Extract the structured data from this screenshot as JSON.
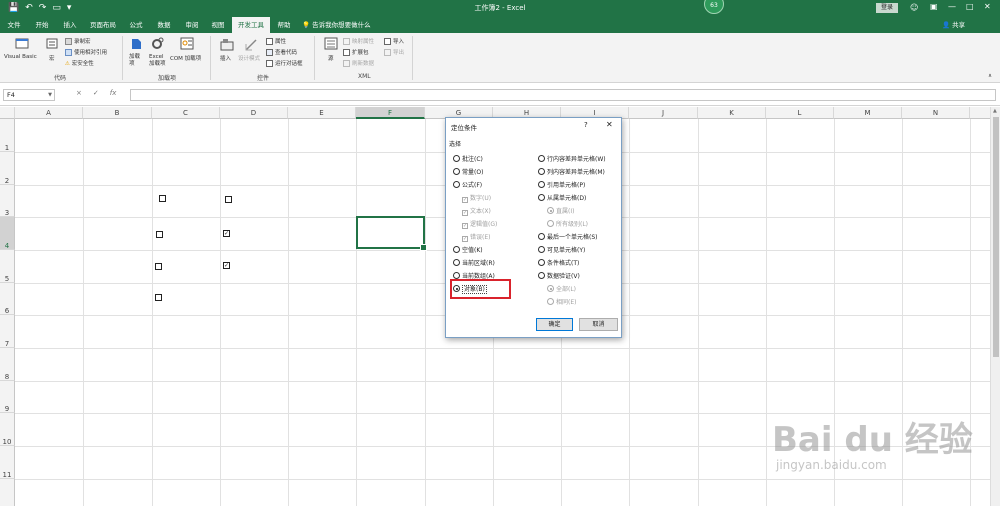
{
  "titlebar": {
    "title": "工作簿2 - Excel",
    "avatar": "63",
    "login": "登录",
    "smile_icon": "smile-icon"
  },
  "tabs": [
    {
      "label": "文件"
    },
    {
      "label": "开始"
    },
    {
      "label": "插入"
    },
    {
      "label": "页面布局"
    },
    {
      "label": "公式"
    },
    {
      "label": "数据"
    },
    {
      "label": "审阅"
    },
    {
      "label": "视图"
    },
    {
      "label": "开发工具",
      "active": true
    },
    {
      "label": "帮助"
    }
  ],
  "tellme": "告诉我你想要做什么",
  "share": "共享",
  "ribbon": {
    "code_group": {
      "visual_basic": "Visual Basic",
      "macros": "宏",
      "record_macro": "录制宏",
      "relative_ref": "使用相对引用",
      "macro_security": "宏安全性",
      "label": "代码"
    },
    "addins_group": {
      "addins": "加载项",
      "excel_addins": "Excel 加载项",
      "com_addins": "COM 加载项",
      "label": "加载项"
    },
    "controls_group": {
      "insert": "插入",
      "design_mode": "设计模式",
      "properties": "属性",
      "view_code": "查看代码",
      "run_dialog": "运行对话框",
      "label": "控件"
    },
    "xml_group": {
      "source": "源",
      "map_props": "映射属性",
      "expansion": "扩展包",
      "refresh": "刷新数据",
      "import": "导入",
      "export": "导出",
      "label": "XML"
    }
  },
  "formula_bar": {
    "name_box": "F4",
    "cancel_icon": "×",
    "enter_icon": "✓",
    "fx": "fx",
    "formula": ""
  },
  "grid": {
    "columns": [
      "A",
      "B",
      "C",
      "D",
      "E",
      "F",
      "G",
      "H",
      "I",
      "J",
      "K",
      "L",
      "M",
      "N"
    ],
    "rows": [
      "1",
      "2",
      "3",
      "4",
      "5",
      "6",
      "7",
      "8",
      "9",
      "10",
      "11"
    ],
    "selected_column": "F",
    "selected_row": "4"
  },
  "dialog": {
    "title": "定位条件",
    "help": "?",
    "close": "✕",
    "section": "选择",
    "left_options": [
      {
        "label": "批注(C)"
      },
      {
        "label": "常量(O)"
      },
      {
        "label": "公式(F)"
      },
      {
        "label": "数字(U)",
        "sub": true
      },
      {
        "label": "文本(X)",
        "sub": true
      },
      {
        "label": "逻辑值(G)",
        "sub": true
      },
      {
        "label": "错误(E)",
        "sub": true
      },
      {
        "label": "空值(K)"
      },
      {
        "label": "当前区域(R)"
      },
      {
        "label": "当前数组(A)"
      },
      {
        "label": "对象(B)",
        "selected": true
      }
    ],
    "right_options": [
      {
        "label": "行内容差异单元格(W)"
      },
      {
        "label": "列内容差异单元格(M)"
      },
      {
        "label": "引用单元格(P)"
      },
      {
        "label": "从属单元格(D)"
      },
      {
        "label": "直属(I)",
        "sub": true
      },
      {
        "label": "所有级别(L)",
        "sub": true
      },
      {
        "label": "最后一个单元格(S)"
      },
      {
        "label": "可见单元格(Y)"
      },
      {
        "label": "条件格式(T)"
      },
      {
        "label": "数据验证(V)"
      },
      {
        "label": "全部(L)",
        "sub": true
      },
      {
        "label": "相同(E)",
        "sub": true
      }
    ],
    "ok": "确定",
    "cancel": "取消"
  },
  "watermark": {
    "brand": "Bai du 经验",
    "url": "jingyan.baidu.com"
  }
}
